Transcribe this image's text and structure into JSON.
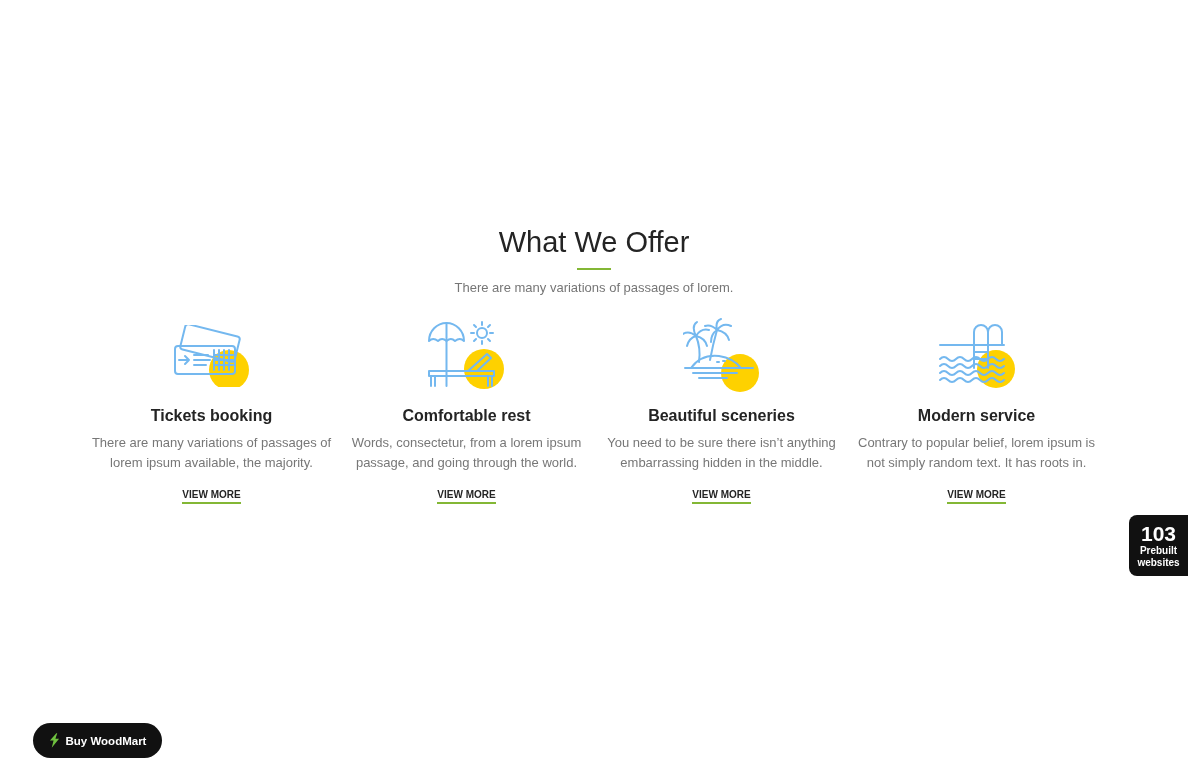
{
  "section": {
    "title": "What We Offer",
    "subtitle": "There are many variations of passages of lorem."
  },
  "services": [
    {
      "kind": "tickets",
      "title": "Tickets booking",
      "text": "There are many variations of passages of lorem ipsum available, the majority.",
      "link": "VIEW MORE"
    },
    {
      "kind": "lounger",
      "title": "Comfortable rest",
      "text": "Words, consectetur, from a lorem ipsum passage, and going through the world.",
      "link": "VIEW MORE"
    },
    {
      "kind": "island",
      "title": "Beautiful sceneries",
      "text": "You need to be sure there isn’t anything embarrassing hidden in the middle.",
      "link": "VIEW MORE"
    },
    {
      "kind": "pool",
      "title": "Modern service",
      "text": "Contrary to popular belief, lorem ipsum is not simply random text. It has roots in.",
      "link": "VIEW MORE"
    }
  ],
  "prebuilt_badge": {
    "count": "103",
    "label": "Prebuilt websites"
  },
  "buy_button": {
    "label": "Buy WoodMart"
  }
}
